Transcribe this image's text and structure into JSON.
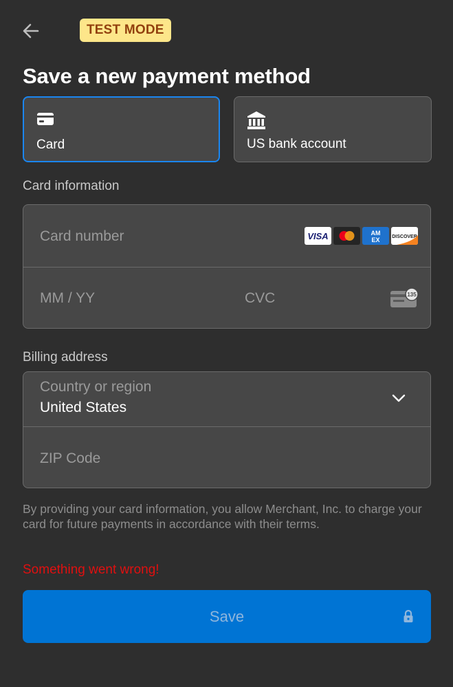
{
  "header": {
    "back_icon": "arrow-left-icon",
    "badge": "TEST MODE"
  },
  "title": "Save a new payment method",
  "tabs": [
    {
      "label": "Card",
      "icon": "card-icon",
      "selected": true
    },
    {
      "label": "US bank account",
      "icon": "bank-icon",
      "selected": false
    }
  ],
  "card_info": {
    "label": "Card information",
    "number_placeholder": "Card number",
    "expiry_placeholder": "MM / YY",
    "cvc_placeholder": "CVC",
    "cvc_hint": "135",
    "brands": [
      "VISA",
      "MASTERCARD",
      "AMEX",
      "DISCOVER"
    ]
  },
  "billing": {
    "label": "Billing address",
    "country_label": "Country or region",
    "country_value": "United States",
    "zip_placeholder": "ZIP Code"
  },
  "disclaimer": "By providing your card information, you allow Merchant, Inc. to charge your card for future payments in accordance with their terms.",
  "error": "Something went wrong!",
  "save_button": {
    "label": "Save",
    "icon": "lock-icon"
  },
  "colors": {
    "background": "#2e2e2e",
    "accent": "#0074d4",
    "selected_border": "#1a86f0",
    "error": "#e01010",
    "badge_bg": "#fde68a",
    "badge_text": "#92400e"
  }
}
